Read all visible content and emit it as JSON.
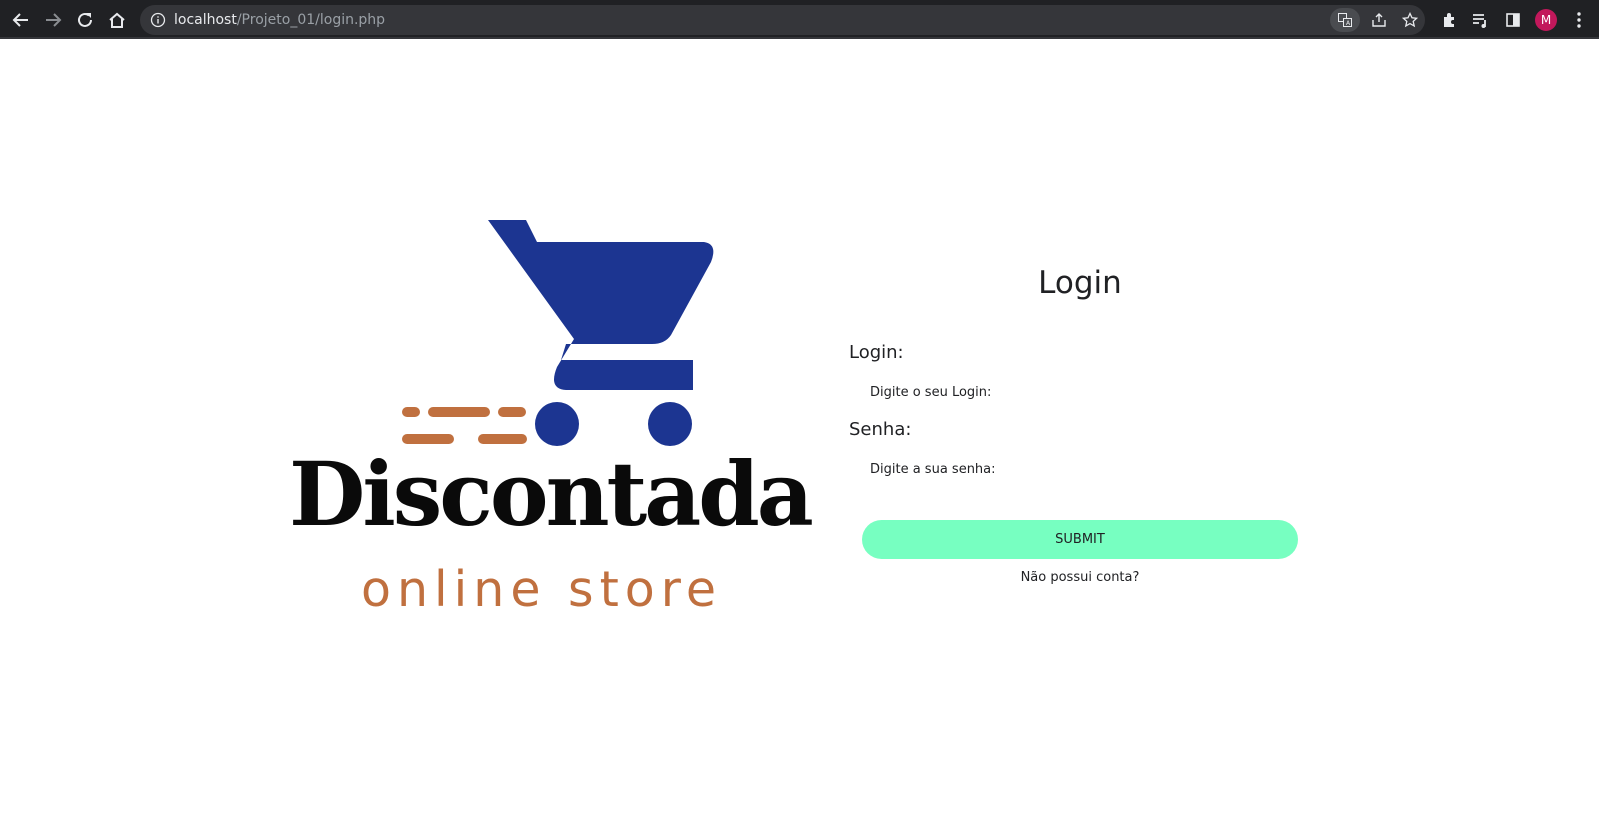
{
  "browser": {
    "url_host": "localhost",
    "url_path": "/Projeto_01/login.php",
    "profile_initial": "M",
    "icons": [
      "back-icon",
      "forward-icon",
      "reload-icon",
      "home-icon",
      "site-info-icon",
      "translate-icon",
      "share-icon",
      "bookmark-star-icon",
      "extensions-icon",
      "reading-list-icon",
      "side-panel-icon",
      "menu-icon"
    ]
  },
  "logo": {
    "name": "Discontada",
    "tagline": "online store",
    "cart_color": "#1c3591",
    "tagline_color": "#c0703f"
  },
  "form": {
    "title": "Login",
    "login_label": "Login:",
    "login_placeholder": "Digite o seu Login:",
    "password_label": "Senha:",
    "password_placeholder": "Digite a sua senha:",
    "submit_label": "SUBMIT",
    "signup_link": "Não possui conta?",
    "submit_color": "#77ffc1"
  }
}
